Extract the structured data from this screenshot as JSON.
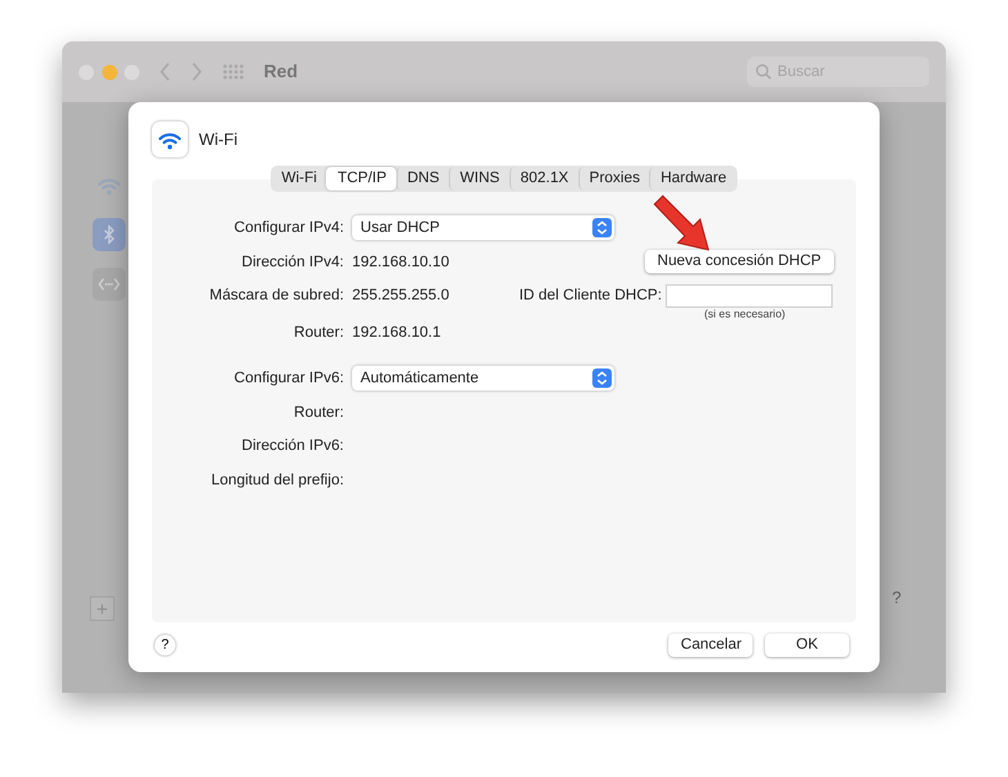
{
  "window": {
    "title": "Red",
    "search": {
      "placeholder": "Buscar"
    },
    "add_button": "+",
    "help_button": "?"
  },
  "dialog": {
    "service": "Wi-Fi",
    "tabs": [
      {
        "label": "Wi-Fi",
        "selected": false
      },
      {
        "label": "TCP/IP",
        "selected": true
      },
      {
        "label": "DNS",
        "selected": false
      },
      {
        "label": "WINS",
        "selected": false
      },
      {
        "label": "802.1X",
        "selected": false
      },
      {
        "label": "Proxies",
        "selected": false
      },
      {
        "label": "Hardware",
        "selected": false
      }
    ],
    "ipv4_rows": [
      {
        "kind": "popup",
        "label": "Configurar IPv4:",
        "value": "Usar DHCP"
      },
      {
        "kind": "text",
        "label": "Dirección IPv4:",
        "value": "192.168.10.10"
      },
      {
        "kind": "text",
        "label": "Máscara de subred:",
        "value": "255.255.255.0"
      },
      {
        "kind": "text",
        "label": "Router:",
        "value": "192.168.10.1"
      }
    ],
    "renew_button": "Nueva concesión DHCP",
    "client_id": {
      "label": "ID del Cliente DHCP:",
      "hint": "(si es necesario)"
    },
    "ipv6_rows": [
      {
        "kind": "popup",
        "label": "Configurar IPv6:",
        "value": "Automáticamente"
      },
      {
        "kind": "text",
        "label": "Router:"
      },
      {
        "kind": "text",
        "label": "Dirección IPv6:"
      },
      {
        "kind": "text",
        "label": "Longitud del prefijo:"
      }
    ],
    "help": "?",
    "buttons": [
      "Cancelar",
      "OK"
    ]
  }
}
